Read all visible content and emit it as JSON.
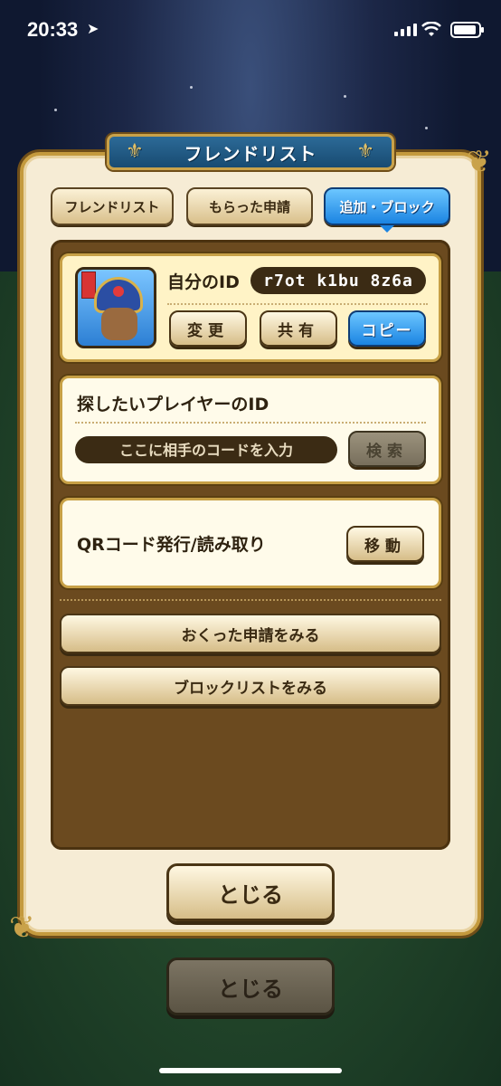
{
  "status_bar": {
    "time": "20:33",
    "location_icon": "location-arrow-icon",
    "signal_icon": "signal-bars-icon",
    "wifi_icon": "wifi-icon",
    "battery_icon": "battery-icon"
  },
  "dialog": {
    "title": "フレンドリスト",
    "tabs": [
      {
        "label": "フレンドリスト",
        "active": false
      },
      {
        "label": "もらった申請",
        "active": false
      },
      {
        "label": "追加・ブロック",
        "active": true
      }
    ],
    "my_id": {
      "label": "自分のID",
      "value": "r7ot k1bu 8z6a",
      "buttons": {
        "change": "変更",
        "share": "共有",
        "copy": "コピー"
      }
    },
    "search": {
      "label": "探したいプレイヤーのID",
      "placeholder": "ここに相手のコードを入力",
      "button": "検索"
    },
    "qr": {
      "label": "QRコード発行/読み取り",
      "button": "移動"
    },
    "sent_requests_button": "おくった申請をみる",
    "block_list_button": "ブロックリストをみる",
    "close_button": "とじる"
  },
  "background": {
    "close_button": "とじる"
  },
  "colors": {
    "accent_blue": "#1b84e2",
    "frame_gold": "#c49a3e",
    "panel_brown": "#6b4a1f",
    "cream": "#f6ecd5"
  }
}
